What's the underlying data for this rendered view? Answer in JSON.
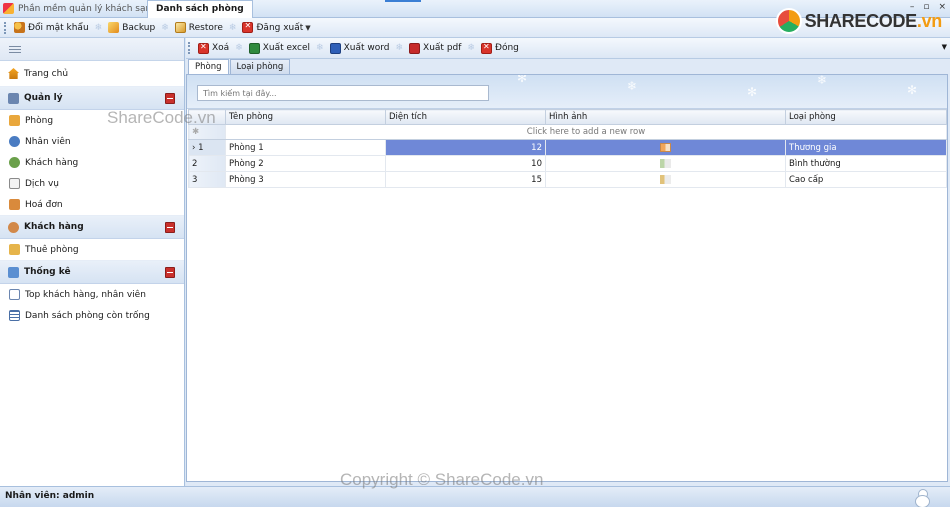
{
  "window": {
    "app_title": "Phần mềm quản lý khách sạn",
    "active_tab": "Danh sách phòng",
    "controls": [
      "–",
      "▫",
      "×"
    ]
  },
  "toolbar": {
    "items": [
      {
        "label": "Đổi mật khẩu",
        "icon": "key-icon"
      },
      {
        "label": "Backup",
        "icon": "backup-icon"
      },
      {
        "label": "Restore",
        "icon": "restore-icon"
      },
      {
        "label": "Đăng xuất",
        "icon": "logout-icon"
      }
    ]
  },
  "logo": {
    "text_main": "SHARECODE",
    "text_suffix": ".vn"
  },
  "sidebar": {
    "home": "Trang chủ",
    "groups": [
      {
        "title": "Quản lý",
        "items": [
          "Phòng",
          "Nhân viên",
          "Khách hàng",
          "Dịch vụ",
          "Hoá đơn"
        ]
      },
      {
        "title": "Khách hàng",
        "items": [
          "Thuê phòng"
        ]
      },
      {
        "title": "Thống kê",
        "items": [
          "Top khách hàng, nhân viên",
          "Danh sách phòng còn trống"
        ]
      }
    ]
  },
  "subtoolbar": {
    "delete": "Xoá",
    "export_excel": "Xuất excel",
    "export_word": "Xuất word",
    "export_pdf": "Xuất pdf",
    "close": "Đóng"
  },
  "tabs": [
    "Phòng",
    "Loại phòng"
  ],
  "search": {
    "placeholder": "Tìm kiếm tại đây..."
  },
  "grid": {
    "columns": [
      "Tên phòng",
      "Diện tích",
      "Hình ảnh",
      "Loại phòng"
    ],
    "add_row_text": "Click here to add a new row",
    "rows": [
      {
        "num": "1",
        "name": "Phòng 1",
        "area": "12",
        "type": "Thương gia"
      },
      {
        "num": "2",
        "name": "Phòng 2",
        "area": "10",
        "type": "Bình thường"
      },
      {
        "num": "3",
        "name": "Phòng 3",
        "area": "15",
        "type": "Cao cấp"
      }
    ],
    "selected_row": 1
  },
  "status": {
    "user": "Nhân viên: admin"
  },
  "watermarks": {
    "top": "ShareCode.vn",
    "bottom": "Copyright © ShareCode.vn"
  }
}
